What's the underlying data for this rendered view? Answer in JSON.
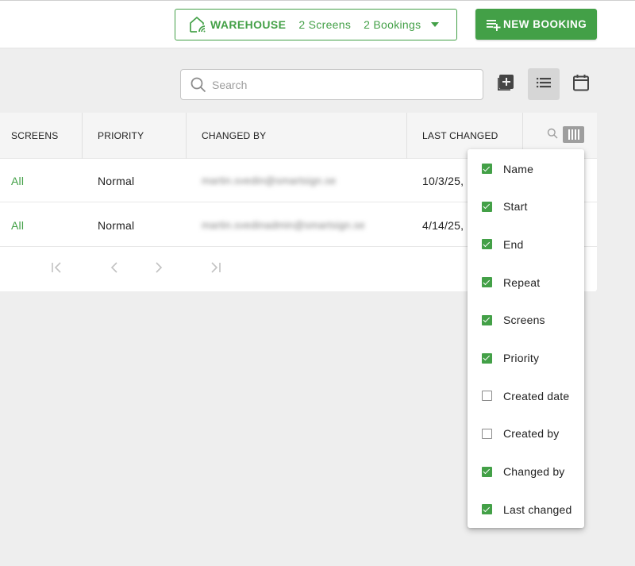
{
  "colors": {
    "accent": "#43a047",
    "header_bg": "#f5f5f5",
    "page_bg": "#eeeeee",
    "active_tool_bg": "#d6d6d6"
  },
  "location": {
    "icon": "location-signal-icon",
    "name": "WAREHOUSE",
    "screens": "2 Screens",
    "bookings": "2 Bookings"
  },
  "new_booking": {
    "label": "NEW BOOKING",
    "icon": "playlist-add-icon"
  },
  "search": {
    "placeholder": "Search",
    "value": ""
  },
  "toolbar": {
    "add_icon": "add-box-icon",
    "list_icon": "list-view-icon",
    "calendar_icon": "calendar-icon",
    "active_view": "list"
  },
  "table": {
    "columns": [
      "SCREENS",
      "PRIORITY",
      "CHANGED BY",
      "LAST CHANGED"
    ],
    "rows": [
      {
        "screens": "All",
        "priority": "Normal",
        "changed_by": "martin.svedin@smartsign.se",
        "last_changed": "10/3/25,"
      },
      {
        "screens": "All",
        "priority": "Normal",
        "changed_by": "martin.svedinadmin@smartsign.se",
        "last_changed": "4/14/25,"
      }
    ]
  },
  "pagination": {
    "first_icon": "first-page-icon",
    "prev_icon": "chevron-left-icon",
    "next_icon": "chevron-right-icon",
    "last_icon": "last-page-icon"
  },
  "column_menu": {
    "items": [
      {
        "label": "Name",
        "checked": true
      },
      {
        "label": "Start",
        "checked": true
      },
      {
        "label": "End",
        "checked": true
      },
      {
        "label": "Repeat",
        "checked": true
      },
      {
        "label": "Screens",
        "checked": true
      },
      {
        "label": "Priority",
        "checked": true
      },
      {
        "label": "Created date",
        "checked": false
      },
      {
        "label": "Created by",
        "checked": false
      },
      {
        "label": "Changed by",
        "checked": true
      },
      {
        "label": "Last changed",
        "checked": true
      }
    ]
  }
}
